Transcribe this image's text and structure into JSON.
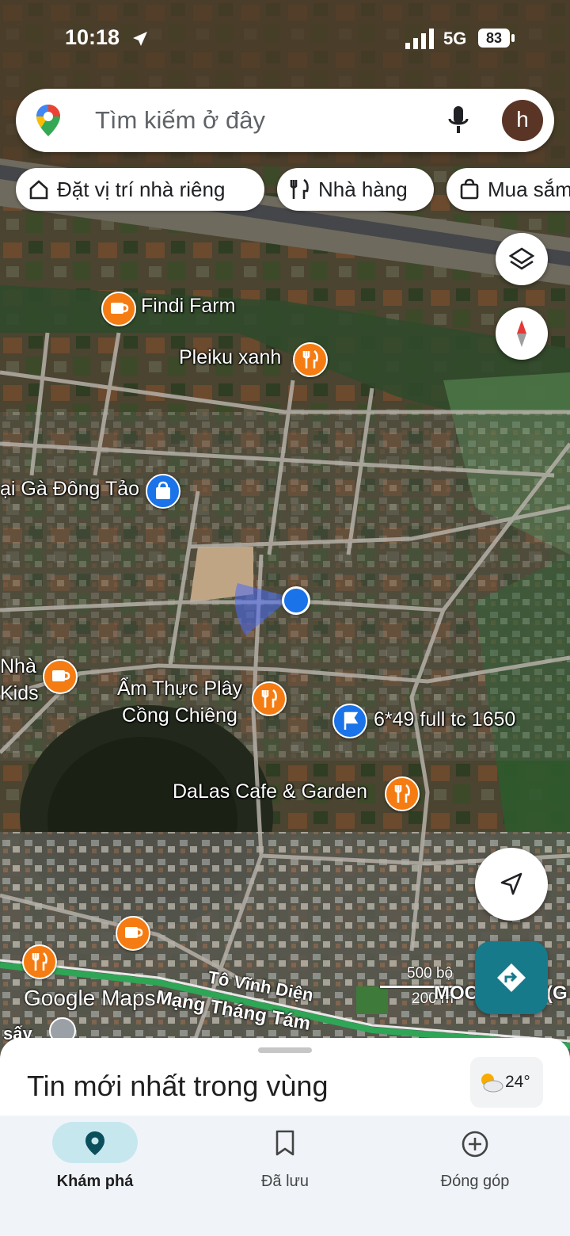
{
  "status_bar": {
    "time": "10:18",
    "network": "5G",
    "battery": "83"
  },
  "search": {
    "placeholder": "Tìm kiếm ở đây",
    "avatar_letter": "h"
  },
  "chips": [
    {
      "label": "Đặt vị trí nhà riêng",
      "icon": "home-icon"
    },
    {
      "label": "Nhà hàng",
      "icon": "restaurant-icon"
    },
    {
      "label": "Mua sắm",
      "icon": "shopping-bag-icon"
    }
  ],
  "map": {
    "pois": [
      {
        "label": "Findi Farm",
        "category": "cafe"
      },
      {
        "label": "Pleiku xanh",
        "category": "restaurant"
      },
      {
        "label": "ại Gà Đông Tảo",
        "category": "shop"
      },
      {
        "label": "Nhà\nKids",
        "category": "cafe"
      },
      {
        "label": "Ẩm Thực Plây\nCồng Chiêng",
        "category": "restaurant"
      },
      {
        "label": "6*49 full tc 1650",
        "category": "flag"
      },
      {
        "label": "DaLas Cafe & Garden",
        "category": "restaurant"
      }
    ],
    "roads": [
      "Tô Vĩnh Diện",
      "Mạng Tháng Tám"
    ],
    "fragments": {
      "left_bottom": "sấy",
      "right_bottom": "MOC",
      "right_paren": "(G"
    },
    "watermark": "Google Maps",
    "scale": {
      "label": "500 bộ",
      "label2": "200 m"
    }
  },
  "sheet": {
    "title": "Tin mới nhất trong vùng",
    "temperature": "24°"
  },
  "nav": [
    {
      "label": "Khám phá",
      "icon": "explore-pin-icon",
      "active": true
    },
    {
      "label": "Đã lưu",
      "icon": "bookmark-icon",
      "active": false
    },
    {
      "label": "Đóng góp",
      "icon": "add-circle-icon",
      "active": false
    }
  ],
  "colors": {
    "accent": "#1a73e8",
    "poi_orange": "#f57c12",
    "directions": "#167a8a",
    "nav_active": "#c7e7ef"
  }
}
